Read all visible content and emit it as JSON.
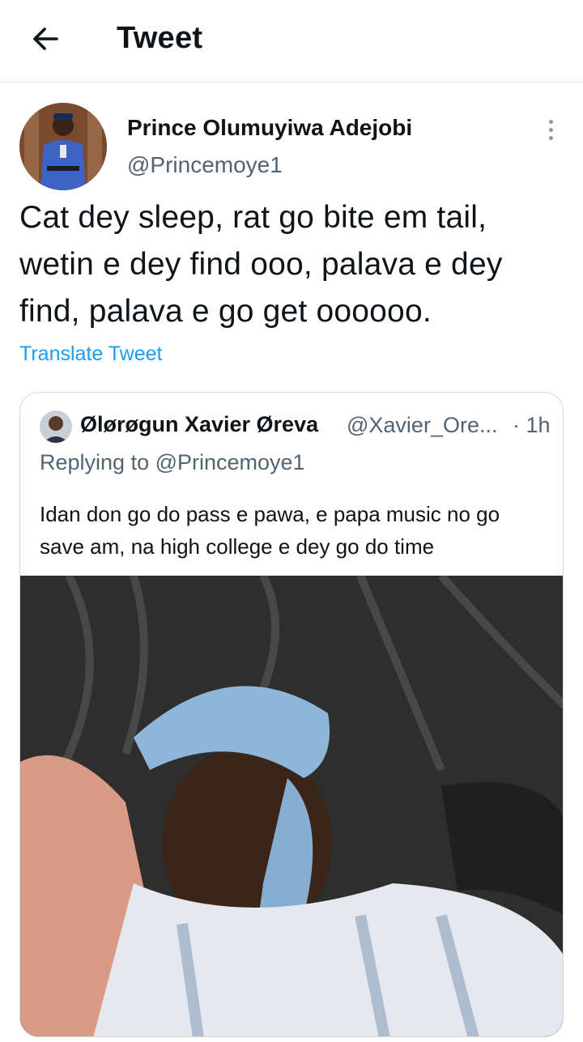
{
  "header": {
    "title": "Tweet",
    "back_icon": "arrow-left-icon"
  },
  "tweet": {
    "author_name": "Prince Olumuyiwa Adejobi",
    "author_handle": "@Princemoye1",
    "text": "Cat dey sleep, rat go bite em tail, wetin e dey find ooo, palava e dey find, palava e go get oooooo.",
    "translate_label": "Translate Tweet",
    "more_icon": "more-vertical-icon"
  },
  "quote": {
    "author_name": "Ølørøgun Xavier Øreva",
    "author_handle": "@Xavier_Ore...",
    "time": "· 1h",
    "replying_to": "Replying to @Princemoye1",
    "text": "Idan don go do pass e pawa, e papa music no go save am, na high college e dey go do time"
  },
  "colors": {
    "accent": "#1d9bf0",
    "secondary_text": "#536471",
    "border": "#cfd9de"
  }
}
